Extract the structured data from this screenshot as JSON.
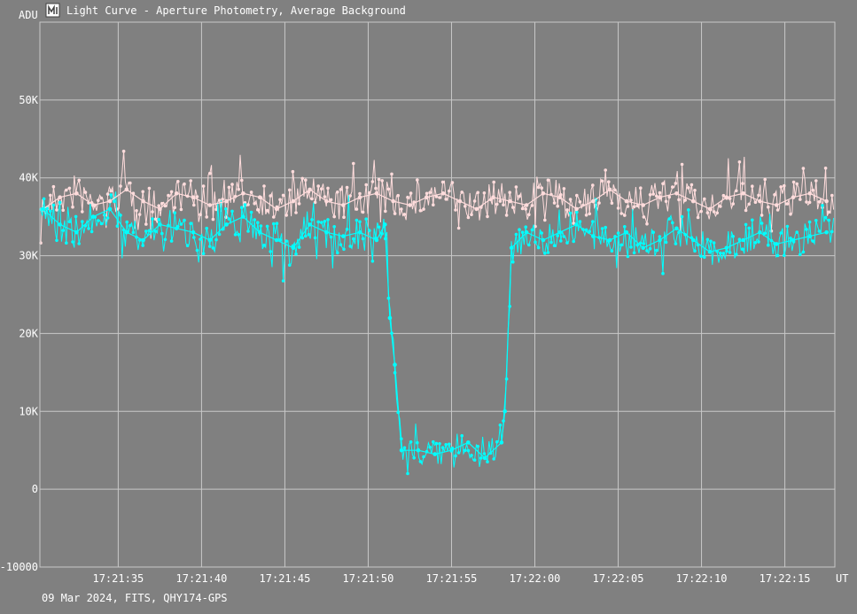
{
  "window": {
    "title": "Light Curve - Aperture Photometry, Average Background",
    "icon": "light-curve-app-icon"
  },
  "footer": {
    "caption": "09 Mar 2024, FITS, QHY174-GPS"
  },
  "chart_data": {
    "type": "line",
    "title": "Light Curve - Aperture Photometry, Average Background",
    "ylabel": "ADU",
    "xlabel": "UT",
    "ylim": [
      -10000,
      60000
    ],
    "xlim": [
      "17:21:30.3",
      "17:22:18.0"
    ],
    "y_ticks": [
      {
        "value": 50000,
        "label": "50K"
      },
      {
        "value": 40000,
        "label": "40K"
      },
      {
        "value": 30000,
        "label": "30K"
      },
      {
        "value": 20000,
        "label": "20K"
      },
      {
        "value": 10000,
        "label": "10K"
      },
      {
        "value": 0,
        "label": "0"
      },
      {
        "value": -10000,
        "label": "-10000"
      }
    ],
    "x_ticks": [
      {
        "value": "17:21:35",
        "label": "17:21:35"
      },
      {
        "value": "17:21:40",
        "label": "17:21:40"
      },
      {
        "value": "17:21:45",
        "label": "17:21:45"
      },
      {
        "value": "17:21:50",
        "label": "17:21:50"
      },
      {
        "value": "17:21:55",
        "label": "17:21:55"
      },
      {
        "value": "17:22:00",
        "label": "17:22:00"
      },
      {
        "value": "17:22:05",
        "label": "17:22:05"
      },
      {
        "value": "17:22:10",
        "label": "17:22:10"
      },
      {
        "value": "17:22:15",
        "label": "17:22:15"
      }
    ],
    "grid": true,
    "legend": "none",
    "series": [
      {
        "color": "#ffdcdc",
        "x": [
          "17:21:30.5",
          "17:21:31.5",
          "17:21:32.5",
          "17:21:33.5",
          "17:21:34.5",
          "17:21:35.5",
          "17:21:36.5",
          "17:21:37.5",
          "17:21:38.5",
          "17:21:39.5",
          "17:21:40.5",
          "17:21:41.5",
          "17:21:42.5",
          "17:21:43.5",
          "17:21:44.5",
          "17:21:45.5",
          "17:21:46.5",
          "17:21:47.5",
          "17:21:48.5",
          "17:21:49.5",
          "17:21:50.5",
          "17:21:51.5",
          "17:21:52.5",
          "17:21:53.5",
          "17:21:54.5",
          "17:21:55.5",
          "17:21:56.5",
          "17:21:57.5",
          "17:21:58.5",
          "17:21:59.5",
          "17:22:00.5",
          "17:22:01.5",
          "17:22:02.5",
          "17:22:03.5",
          "17:22:04.5",
          "17:22:05.5",
          "17:22:06.5",
          "17:22:07.5",
          "17:22:08.5",
          "17:22:09.5",
          "17:22:10.5",
          "17:22:11.5",
          "17:22:12.5",
          "17:22:13.5",
          "17:22:14.5",
          "17:22:15.5",
          "17:22:16.5",
          "17:22:17.5"
        ],
        "values": [
          36000,
          37500,
          38000,
          36500,
          37000,
          38500,
          37000,
          36000,
          38000,
          37500,
          36500,
          37000,
          38000,
          37500,
          36000,
          37000,
          38500,
          37000,
          36500,
          37500,
          38000,
          37000,
          36500,
          37500,
          38000,
          37000,
          36000,
          37500,
          37000,
          36500,
          38000,
          37500,
          36000,
          37000,
          38500,
          37000,
          36500,
          37500,
          38000,
          37000,
          36000,
          37500,
          38000,
          37000,
          36500,
          37500,
          38000,
          37000
        ]
      },
      {
        "color": "#00ffff",
        "x": [
          "17:21:30.5",
          "17:21:31.5",
          "17:21:32.5",
          "17:21:33.5",
          "17:21:34.5",
          "17:21:35.5",
          "17:21:36.5",
          "17:21:37.5",
          "17:21:38.5",
          "17:21:39.5",
          "17:21:40.5",
          "17:21:41.5",
          "17:21:42.5",
          "17:21:43.5",
          "17:21:44.5",
          "17:21:45.5",
          "17:21:46.5",
          "17:21:47.5",
          "17:21:48.5",
          "17:21:49.5",
          "17:21:50.5",
          "17:21:51.0",
          "17:21:51.3",
          "17:21:51.6",
          "17:21:52.0",
          "17:21:53.0",
          "17:21:54.0",
          "17:21:55.0",
          "17:21:56.0",
          "17:21:57.0",
          "17:21:58.0",
          "17:21:58.2",
          "17:21:58.6",
          "17:21:59.5",
          "17:22:00.5",
          "17:22:01.5",
          "17:22:02.5",
          "17:22:03.5",
          "17:22:04.5",
          "17:22:05.5",
          "17:22:06.5",
          "17:22:07.5",
          "17:22:08.5",
          "17:22:09.5",
          "17:22:10.5",
          "17:22:11.5",
          "17:22:12.5",
          "17:22:13.5",
          "17:22:14.5",
          "17:22:15.5",
          "17:22:16.5",
          "17:22:17.5"
        ],
        "values": [
          36000,
          34000,
          33000,
          35000,
          36000,
          33000,
          32000,
          34000,
          33500,
          33000,
          32000,
          34000,
          35000,
          33000,
          32000,
          31000,
          34000,
          33000,
          32500,
          33000,
          32000,
          34000,
          22000,
          16000,
          5000,
          5000,
          4500,
          5000,
          6000,
          4000,
          6000,
          10000,
          31000,
          33000,
          32000,
          33000,
          34000,
          32500,
          32000,
          33000,
          31000,
          32000,
          33500,
          32000,
          30500,
          31000,
          32000,
          33000,
          31500,
          32000,
          32500,
          33000
        ]
      }
    ]
  }
}
